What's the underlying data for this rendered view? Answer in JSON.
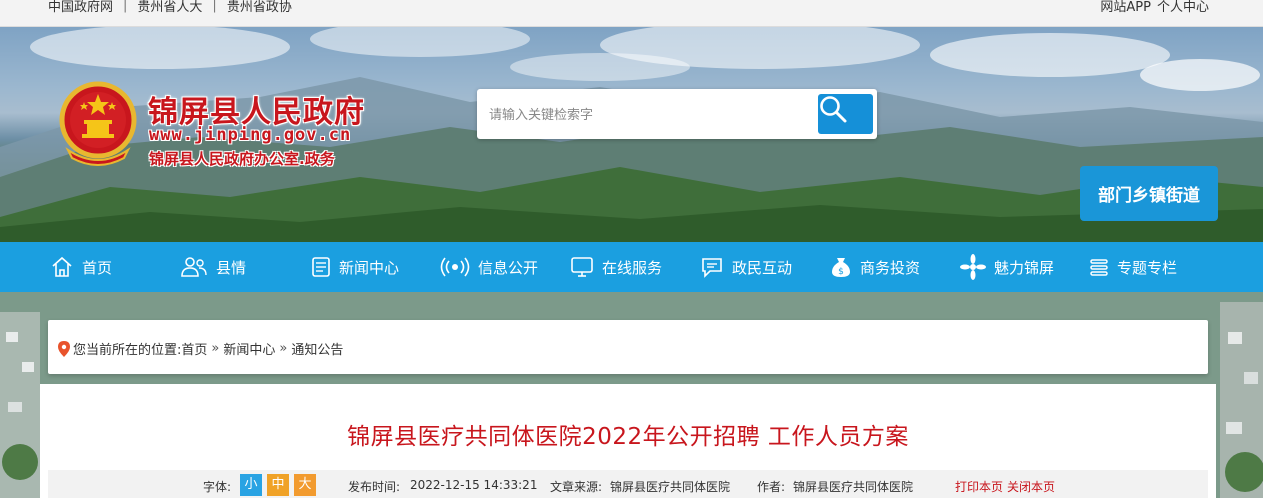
{
  "topbar": {
    "links": [
      "中国政府网",
      "贵州省人大",
      "贵州省政协"
    ],
    "separator": "|",
    "right_links": [
      "网站APP",
      "个人中心"
    ]
  },
  "header": {
    "title": "锦屏县人民政府",
    "url": "www.jinping.gov.cn",
    "subtitle": "锦屏县人民政府办公室.政务",
    "emblem": "national-emblem"
  },
  "search": {
    "placeholder": "请输入关键检索字",
    "button_icon": "search-icon"
  },
  "dept_button": "部门乡镇街道",
  "nav": [
    {
      "label": "首页",
      "icon": "home-icon"
    },
    {
      "label": "县情",
      "icon": "people-icon"
    },
    {
      "label": "新闻中心",
      "icon": "newspaper-icon"
    },
    {
      "label": "信息公开",
      "icon": "broadcast-icon"
    },
    {
      "label": "在线服务",
      "icon": "monitor-icon"
    },
    {
      "label": "政民互动",
      "icon": "chat-icon"
    },
    {
      "label": "商务投资",
      "icon": "money-bag-icon"
    },
    {
      "label": "魅力锦屏",
      "icon": "flower-icon"
    },
    {
      "label": "专题专栏",
      "icon": "stack-icon"
    }
  ],
  "breadcrumb": {
    "prefix": "您当前所在的位置:",
    "items": [
      "首页",
      "新闻中心",
      "通知公告"
    ],
    "separator": "»"
  },
  "article": {
    "title": "锦屏县医疗共同体医院2022年公开招聘 工作人员方案",
    "font_label": "字体:",
    "font_sizes": [
      "小",
      "中",
      "大"
    ],
    "publish_label": "发布时间:",
    "publish_time": "2022-12-15 14:33:21",
    "source_label": "文章来源:",
    "source": "锦屏县医疗共同体医院",
    "author_label": "作者:",
    "author": "锦屏县医疗共同体医院",
    "print_label": "打印本页",
    "close_label": "关闭本页"
  },
  "colors": {
    "brand_red": "#c8161d",
    "nav_blue": "#1b9fe0",
    "search_blue": "#1590d8",
    "font_small": "#29a3e3",
    "font_mid": "#f0a227"
  }
}
